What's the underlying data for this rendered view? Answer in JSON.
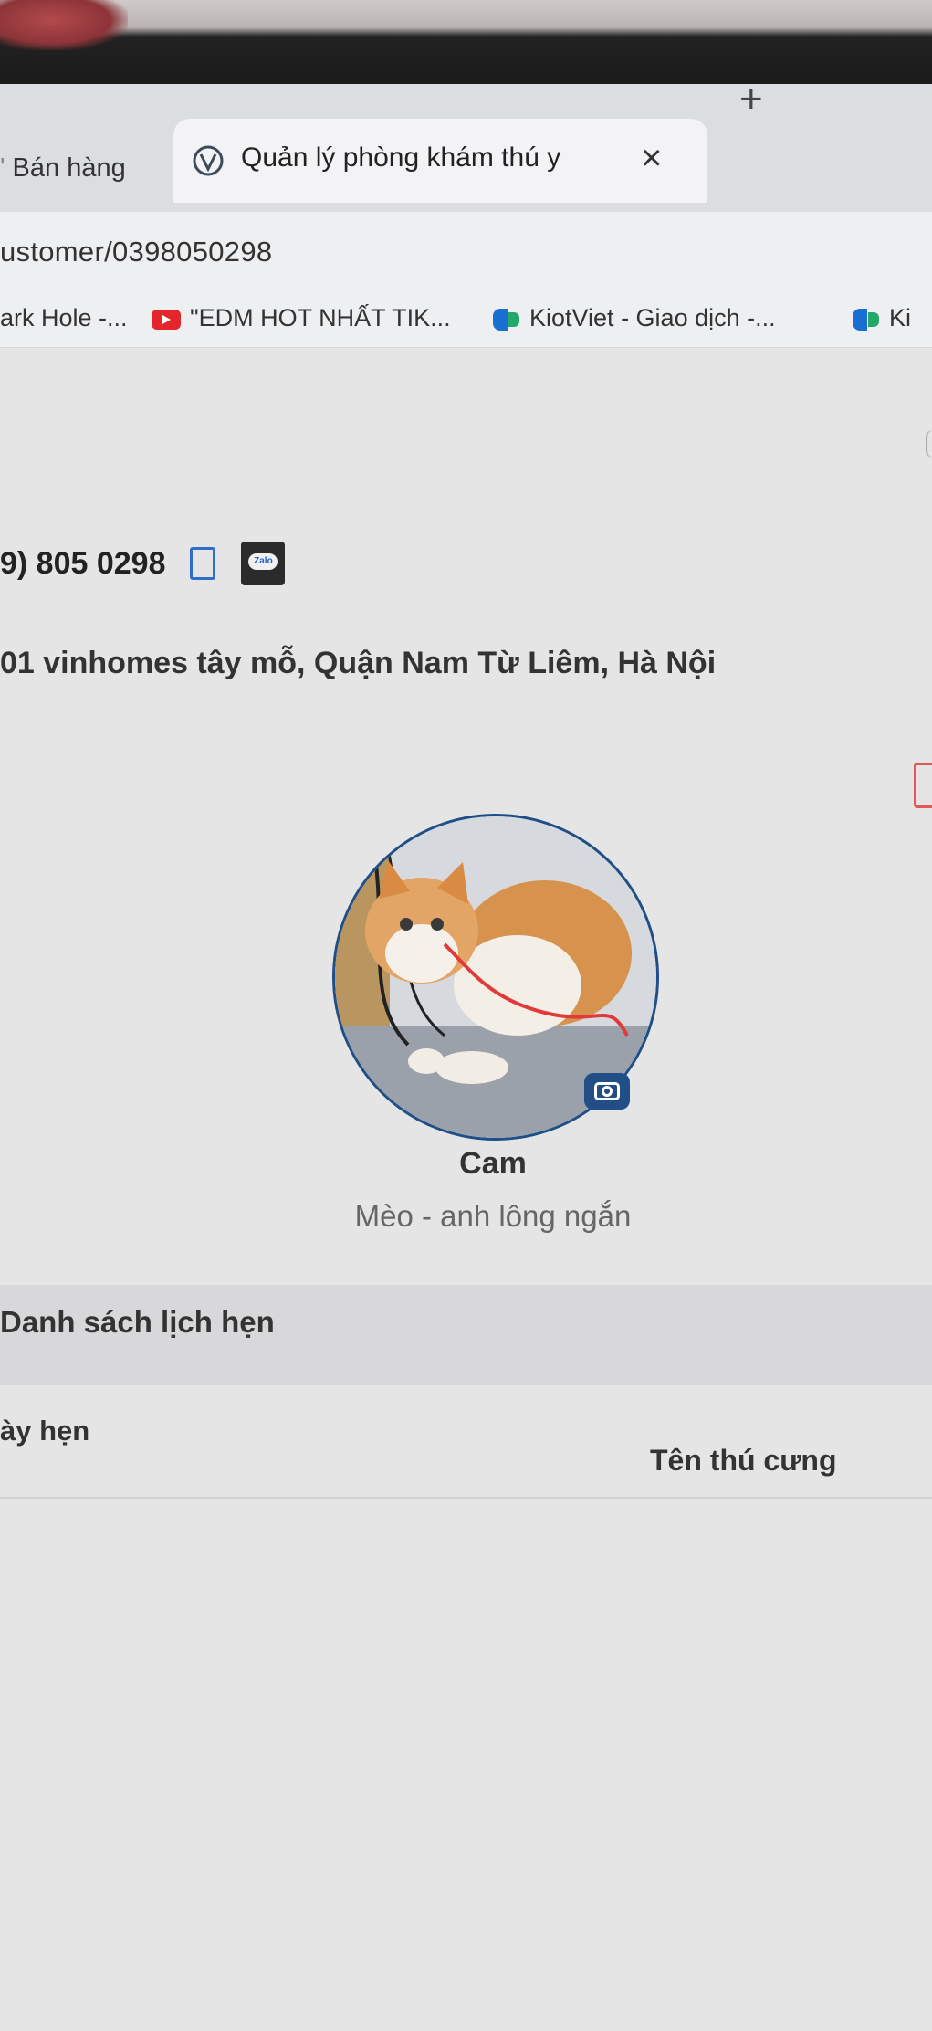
{
  "browser": {
    "tabs": [
      {
        "label": "Bán hàng",
        "active": false
      },
      {
        "label": "Quản lý phòng khám thú y",
        "active": true
      }
    ],
    "close_tab_symbol": "×",
    "new_tab_symbol": "+",
    "url": "ustomer/0398050298",
    "bookmarks": [
      {
        "label": "ark Hole -...",
        "icon": "none"
      },
      {
        "label": "\"EDM HOT NHẤT TIK...",
        "icon": "youtube-icon"
      },
      {
        "label": "KiotViet - Giao dịch -...",
        "icon": "kiotviet-icon"
      },
      {
        "label": "Ki",
        "icon": "kiotviet-icon"
      }
    ]
  },
  "customer": {
    "phone": "9) 805 0298",
    "zalo_label": "Zalo",
    "address": "01 vinhomes tây mỗ, Quận Nam Từ Liêm, Hà Nội"
  },
  "pet": {
    "name": "Cam",
    "breed": "Mèo - anh lông ngắn"
  },
  "appointments": {
    "title": "Danh sách lịch hẹn",
    "columns": [
      "ày hẹn",
      "Tên thú cưng"
    ]
  },
  "colors": {
    "accent": "#214e86",
    "link_blue": "#2f6fc7",
    "danger": "#e05a5a"
  }
}
